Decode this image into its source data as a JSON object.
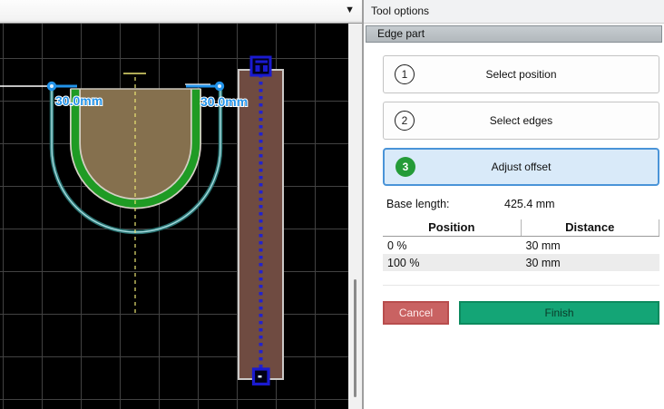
{
  "toolbar": {
    "dropdown_icon": "▼"
  },
  "canvas": {
    "dimension_labels": [
      "30.0mm",
      "30.0mm"
    ],
    "colors": {
      "background": "#000000",
      "grid": "#424242",
      "pocket_tan": "#85704e",
      "outline_green": "#1f9b24",
      "offset_teal": "#2a7473",
      "part_brown": "#6f4b41",
      "marker_blue": "#1a1ad0",
      "centerline_yellow": "#eae473",
      "dimension_blue": "#2293ea"
    }
  },
  "panel": {
    "title": "Tool options",
    "section": "Edge part",
    "steps": [
      {
        "number": "1",
        "label": "Select position",
        "active": false
      },
      {
        "number": "2",
        "label": "Select edges",
        "active": false
      },
      {
        "number": "3",
        "label": "Adjust offset",
        "active": true
      }
    ],
    "base_length": {
      "label": "Base length:",
      "value": "425.4 mm"
    },
    "table": {
      "headers": [
        "Position",
        "Distance"
      ],
      "rows": [
        [
          "0 %",
          "30 mm"
        ],
        [
          "100 %",
          "30 mm"
        ]
      ]
    },
    "buttons": {
      "cancel": "Cancel",
      "finish": "Finish"
    },
    "colors": {
      "step_active_bg": "#d9eaf9",
      "step_active_border": "#4a94d8",
      "badge_green": "#259b38",
      "cancel_red": "#c96262",
      "finish_green": "#14a576"
    }
  }
}
